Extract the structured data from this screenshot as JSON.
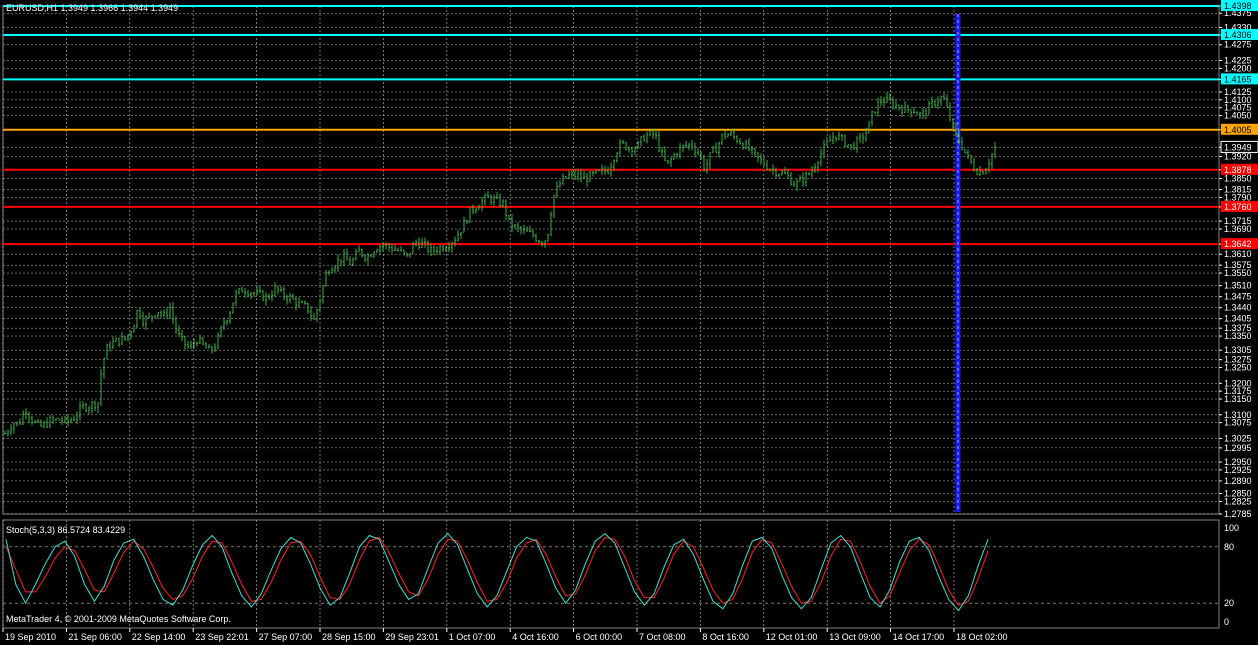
{
  "header": {
    "symbol_text": "EURUSD,H1",
    "ohlc_text": "1.3949 1.3966 1.3944 1.3949"
  },
  "indicator": {
    "label": "Stoch(5,3,3)",
    "values_text": "86.5724 83.4229"
  },
  "footer": {
    "copyright": "MetaTrader 4, © 2001-2009 MetaQuotes Software Corp."
  },
  "colors": {
    "background": "#000000",
    "grid": "#c0c0c0",
    "candle": "#3cb043",
    "stoch_main": "#40e0d0",
    "stoch_signal": "#ff2020",
    "vline": "#1a1aff",
    "support": "#ff0000",
    "resistance": "#00ffff",
    "pivot": "#ffa500"
  },
  "chart_data": [
    {
      "type": "candlestick",
      "title": "EURUSD,H1",
      "ylim": [
        1.2785,
        1.4398
      ],
      "y_ticks": [
        "1.4398",
        "1.4375",
        "1.4330",
        "1.4306",
        "1.4275",
        "1.4225",
        "1.4200",
        "1.4165",
        "1.4125",
        "1.4100",
        "1.4075",
        "1.4050",
        "1.4005",
        "1.3949",
        "1.3920",
        "1.3878",
        "1.3850",
        "1.3815",
        "1.3790",
        "1.3760",
        "1.3715",
        "1.3690",
        "1.3642",
        "1.3610",
        "1.3575",
        "1.3550",
        "1.3510",
        "1.3475",
        "1.3440",
        "1.3405",
        "1.3375",
        "1.3350",
        "1.3305",
        "1.3275",
        "1.3250",
        "1.3200",
        "1.3175",
        "1.3150",
        "1.3100",
        "1.3075",
        "1.3025",
        "1.2995",
        "1.2950",
        "1.2925",
        "1.2890",
        "1.2850",
        "1.2825",
        "1.2785"
      ],
      "x_labels": [
        "19 Sep 2010",
        "21 Sep 06:00",
        "22 Sep 14:00",
        "23 Sep 22:01",
        "27 Sep 07:00",
        "28 Sep 15:00",
        "29 Sep 23:01",
        "1 Oct 07:00",
        "4 Oct 16:00",
        "6 Oct 00:00",
        "7 Oct 08:00",
        "8 Oct 16:00",
        "12 Oct 01:00",
        "13 Oct 09:00",
        "14 Oct 17:00",
        "18 Oct 02:00"
      ],
      "price_path": [
        [
          0,
          1.304
        ],
        [
          8,
          1.3075
        ],
        [
          14,
          1.307
        ],
        [
          20,
          1.312
        ],
        [
          28,
          1.308
        ],
        [
          35,
          1.306
        ],
        [
          45,
          1.308
        ],
        [
          55,
          1.3085
        ],
        [
          62,
          1.3075
        ],
        [
          70,
          1.3095
        ],
        [
          78,
          1.3125
        ],
        [
          85,
          1.313
        ],
        [
          93,
          1.314
        ],
        [
          97,
          1.326
        ],
        [
          103,
          1.332
        ],
        [
          112,
          1.3335
        ],
        [
          120,
          1.334
        ],
        [
          128,
          1.338
        ],
        [
          133,
          1.344
        ],
        [
          138,
          1.34
        ],
        [
          146,
          1.341
        ],
        [
          152,
          1.3435
        ],
        [
          158,
          1.341
        ],
        [
          165,
          1.344
        ],
        [
          172,
          1.336
        ],
        [
          178,
          1.333
        ],
        [
          185,
          1.331
        ],
        [
          192,
          1.334
        ],
        [
          198,
          1.332
        ],
        [
          205,
          1.33
        ],
        [
          212,
          1.333
        ],
        [
          218,
          1.339
        ],
        [
          224,
          1.342
        ],
        [
          230,
          1.348
        ],
        [
          238,
          1.35
        ],
        [
          246,
          1.349
        ],
        [
          255,
          1.348
        ],
        [
          262,
          1.347
        ],
        [
          270,
          1.35
        ],
        [
          278,
          1.348
        ],
        [
          286,
          1.347
        ],
        [
          294,
          1.345
        ],
        [
          302,
          1.344
        ],
        [
          309,
          1.34
        ],
        [
          316,
          1.348
        ],
        [
          322,
          1.356
        ],
        [
          330,
          1.358
        ],
        [
          338,
          1.36
        ],
        [
          346,
          1.358
        ],
        [
          354,
          1.362
        ],
        [
          362,
          1.36
        ],
        [
          370,
          1.363
        ],
        [
          378,
          1.364
        ],
        [
          386,
          1.363
        ],
        [
          394,
          1.362
        ],
        [
          402,
          1.36
        ],
        [
          410,
          1.365
        ],
        [
          418,
          1.364
        ],
        [
          426,
          1.362
        ],
        [
          434,
          1.363
        ],
        [
          442,
          1.364
        ],
        [
          450,
          1.366
        ],
        [
          458,
          1.37
        ],
        [
          466,
          1.375
        ],
        [
          474,
          1.377
        ],
        [
          482,
          1.379
        ],
        [
          490,
          1.378
        ],
        [
          498,
          1.377
        ],
        [
          504,
          1.371
        ],
        [
          512,
          1.369
        ],
        [
          520,
          1.368
        ],
        [
          528,
          1.367
        ],
        [
          536,
          1.365
        ],
        [
          542,
          1.366
        ],
        [
          548,
          1.379
        ],
        [
          556,
          1.384
        ],
        [
          564,
          1.386
        ],
        [
          572,
          1.386
        ],
        [
          580,
          1.385
        ],
        [
          588,
          1.386
        ],
        [
          596,
          1.387
        ],
        [
          604,
          1.388
        ],
        [
          610,
          1.393
        ],
        [
          616,
          1.396
        ],
        [
          624,
          1.395
        ],
        [
          632,
          1.395
        ],
        [
          638,
          1.398
        ],
        [
          644,
          1.399
        ],
        [
          650,
          1.399
        ],
        [
          656,
          1.393
        ],
        [
          662,
          1.389
        ],
        [
          670,
          1.393
        ],
        [
          678,
          1.395
        ],
        [
          686,
          1.396
        ],
        [
          694,
          1.393
        ],
        [
          700,
          1.388
        ],
        [
          706,
          1.393
        ],
        [
          712,
          1.395
        ],
        [
          718,
          1.399
        ],
        [
          726,
          1.399
        ],
        [
          734,
          1.397
        ],
        [
          742,
          1.395
        ],
        [
          750,
          1.392
        ],
        [
          758,
          1.39
        ],
        [
          766,
          1.388
        ],
        [
          774,
          1.387
        ],
        [
          782,
          1.386
        ],
        [
          790,
          1.383
        ],
        [
          798,
          1.385
        ],
        [
          806,
          1.387
        ],
        [
          814,
          1.392
        ],
        [
          822,
          1.396
        ],
        [
          830,
          1.399
        ],
        [
          838,
          1.397
        ],
        [
          846,
          1.395
        ],
        [
          854,
          1.397
        ],
        [
          862,
          1.4
        ],
        [
          868,
          1.406
        ],
        [
          876,
          1.41
        ],
        [
          884,
          1.4095
        ],
        [
          892,
          1.408
        ],
        [
          900,
          1.407
        ],
        [
          908,
          1.407
        ],
        [
          916,
          1.405
        ],
        [
          924,
          1.4075
        ],
        [
          932,
          1.41
        ],
        [
          938,
          1.411
        ],
        [
          944,
          1.405
        ],
        [
          950,
          1.399
        ],
        [
          956,
          1.396
        ],
        [
          962,
          1.392
        ],
        [
          968,
          1.389
        ],
        [
          974,
          1.387
        ],
        [
          980,
          1.388
        ],
        [
          986,
          1.392
        ],
        [
          990,
          1.3949
        ]
      ],
      "horizontal_lines": [
        {
          "value": 1.4398,
          "label": "1.4398",
          "color": "#00ffff"
        },
        {
          "value": 1.4306,
          "label": "1.4306",
          "color": "#00ffff"
        },
        {
          "value": 1.4165,
          "label": "1.4165",
          "color": "#00ffff"
        },
        {
          "value": 1.4005,
          "label": "1.4005",
          "color": "#ffa500"
        },
        {
          "value": 1.3878,
          "label": "1.3878",
          "color": "#ff0000"
        },
        {
          "value": 1.376,
          "label": "1.3760",
          "color": "#ff0000"
        },
        {
          "value": 1.3642,
          "label": "1.3642",
          "color": "#ff0000"
        }
      ],
      "current_price": "1.3949",
      "vertical_line_time": "18 Oct 02:00"
    },
    {
      "type": "line",
      "title": "Stoch(5,3,3)",
      "ylim": [
        0,
        100
      ],
      "y_ticks": [
        "100",
        "80",
        "20",
        "0"
      ],
      "levels": [
        80,
        20
      ],
      "series": [
        {
          "name": "Stoch main",
          "values": [
            88,
            40,
            20,
            40,
            62,
            80,
            86,
            70,
            40,
            22,
            38,
            66,
            84,
            88,
            70,
            45,
            24,
            18,
            34,
            60,
            82,
            92,
            80,
            52,
            28,
            16,
            30,
            55,
            78,
            90,
            84,
            62,
            36,
            18,
            26,
            52,
            80,
            92,
            88,
            64,
            40,
            24,
            30,
            58,
            84,
            94,
            82,
            56,
            30,
            16,
            28,
            54,
            80,
            90,
            86,
            62,
            36,
            20,
            34,
            62,
            86,
            94,
            84,
            58,
            32,
            18,
            30,
            58,
            82,
            88,
            72,
            46,
            22,
            14,
            30,
            60,
            86,
            90,
            78,
            50,
            26,
            14,
            26,
            56,
            84,
            92,
            80,
            52,
            26,
            16,
            34,
            64,
            86,
            90,
            76,
            48,
            24,
            12,
            28,
            60,
            88
          ]
        },
        {
          "name": "Stoch signal",
          "values": [
            80,
            56,
            32,
            32,
            48,
            68,
            80,
            76,
            56,
            34,
            32,
            52,
            74,
            86,
            78,
            58,
            36,
            24,
            28,
            46,
            70,
            86,
            84,
            64,
            40,
            22,
            24,
            42,
            66,
            84,
            86,
            72,
            48,
            26,
            24,
            40,
            66,
            86,
            90,
            74,
            52,
            32,
            28,
            46,
            72,
            88,
            86,
            66,
            42,
            22,
            24,
            42,
            68,
            84,
            88,
            72,
            48,
            28,
            30,
            50,
            76,
            90,
            88,
            70,
            44,
            26,
            26,
            46,
            72,
            86,
            80,
            58,
            34,
            20,
            24,
            46,
            74,
            88,
            84,
            62,
            38,
            20,
            22,
            42,
            70,
            88,
            86,
            64,
            38,
            20,
            28,
            52,
            76,
            88,
            82,
            60,
            34,
            18,
            22,
            46,
            76
          ]
        }
      ]
    }
  ]
}
